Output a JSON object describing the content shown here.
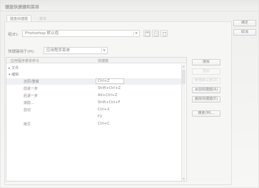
{
  "window": {
    "title": "键盘快捷键和菜单"
  },
  "tabs": [
    {
      "label": "键盘快捷键"
    },
    {
      "label": "菜单"
    }
  ],
  "set_label": "组(E):",
  "set_value": "Photoshop 默认值",
  "shortcuts_for_label": "快捷键用于(H):",
  "shortcuts_for_value": "应用程序菜单",
  "list": {
    "col_command": "应用程序菜单命令",
    "col_shortcut": "快捷键",
    "rows": [
      {
        "name": "▸ 文件",
        "key": ""
      },
      {
        "name": "▾ 编辑",
        "key": ""
      },
      {
        "name": "还原/重做",
        "key": "Ctrl+Z"
      },
      {
        "name": "前进一步",
        "key": "Shift+Ctrl+Z"
      },
      {
        "name": "后退一步",
        "key": "Alt+Ctrl+Z"
      },
      {
        "name": "渐隐...",
        "key": "Shift+Ctrl+F"
      },
      {
        "name": "剪切",
        "key": "Ctrl+X"
      },
      {
        "name": "",
        "key": "F2"
      },
      {
        "name": "拷贝",
        "key": "Ctrl+C"
      }
    ]
  },
  "buttons": {
    "ok": "确定",
    "cancel": "取消",
    "accept": "接受",
    "undo": "还原",
    "use_default": "使用默认值(D)",
    "add_shortcut": "添加快捷键(A)",
    "delete_shortcut": "删除快捷键(E)",
    "summarize": "摘要(M)..."
  }
}
